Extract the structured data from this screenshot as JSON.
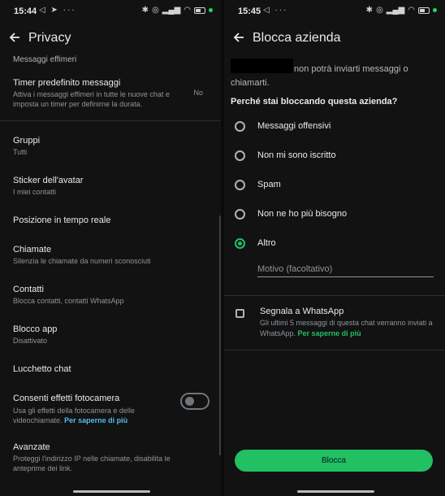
{
  "left": {
    "status": {
      "time": "15:44",
      "left_icons": "◁ ➤ ···"
    },
    "title": "Privacy",
    "section": "Messaggi effimeri",
    "timer": {
      "title": "Timer predefinito messaggi",
      "subtitle": "Attiva i messaggi effimeri in tutte le nuove chat e imposta un timer per definirne la durata.",
      "value": "No"
    },
    "items": [
      {
        "title": "Gruppi",
        "subtitle": "Tutti"
      },
      {
        "title": "Sticker dell'avatar",
        "subtitle": "I miei contatti"
      },
      {
        "title": "Posizione in tempo reale",
        "subtitle": ""
      },
      {
        "title": "Chiamate",
        "subtitle": "Silenzia le chiamate da numeri sconosciuti"
      },
      {
        "title": "Contatti",
        "subtitle": "Blocca contatti, contatti WhatsApp"
      },
      {
        "title": "Blocco app",
        "subtitle": "Disattivato"
      },
      {
        "title": "Lucchetto chat",
        "subtitle": ""
      }
    ],
    "camera": {
      "title": "Consenti effetti fotocamera",
      "subtitle": "Usa gli effetti della fotocamera e delle videochiamate.",
      "link": "Per saperne di più",
      "enabled": false
    },
    "advanced": {
      "title": "Avanzate",
      "subtitle": "Proteggi l'indirizzo IP nelle chiamate, disabilita le anteprime dei link."
    }
  },
  "right": {
    "status": {
      "time": "15:45",
      "left_icons": "◁ ···"
    },
    "title": "Blocca azienda",
    "intro_line1": "non potrà inviarti messaggi o",
    "intro_line2": "chiamarti.",
    "question": "Perché stai bloccando questa azienda?",
    "options": [
      {
        "label": "Messaggi offensivi",
        "selected": false
      },
      {
        "label": "Non mi sono iscritto",
        "selected": false
      },
      {
        "label": "Spam",
        "selected": false
      },
      {
        "label": "Non ne ho più bisogno",
        "selected": false
      },
      {
        "label": "Altro",
        "selected": true
      }
    ],
    "reason_placeholder": "Motivo (facoltativo)",
    "report": {
      "title": "Segnala a WhatsApp",
      "subtitle": "Gli ultimi 5 messaggi di questa chat verranno inviati a WhatsApp.",
      "link": "Per saperne di più",
      "checked": false
    },
    "block_button": "Blocca"
  },
  "colors": {
    "accent_green": "#21c063",
    "link_blue": "#53bdeb",
    "background": "#121212"
  }
}
